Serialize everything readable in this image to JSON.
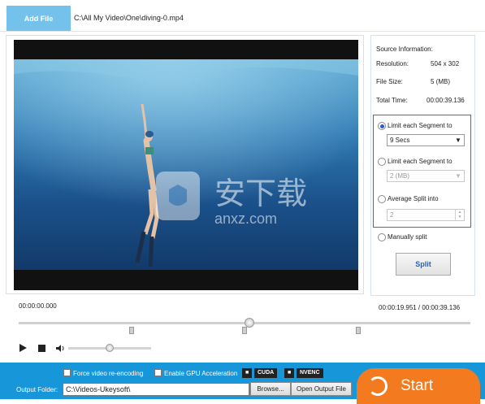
{
  "header": {
    "add_file_label": "Add File",
    "file_path": "C:\\All My Video\\One\\diving-0.mp4"
  },
  "info": {
    "title": "Source Information:",
    "resolution_label": "Resolution:",
    "resolution_value": "504 x 302",
    "filesize_label": "File Size:",
    "filesize_value": "5 (MB)",
    "totaltime_label": "Total Time:",
    "totaltime_value": "00:00:39.136"
  },
  "split_options": {
    "opt1_label": "Limit each Segment to",
    "opt1_value": "9 Secs",
    "opt2_label": "Limit each Segment to",
    "opt2_value": "2 (MB)",
    "opt3_label": "Average Split into",
    "opt3_value": "2",
    "opt4_label": "Manually split",
    "selected": "opt1"
  },
  "split_button_label": "Split",
  "timeline": {
    "current_time": "00:00:00.000",
    "position_display": "00:00:19.951 / 00:00:39.136"
  },
  "bottom": {
    "force_reencoding_label": "Force video re-encoding",
    "gpu_label": "Enable GPU Acceleration",
    "cuda_badge": "CUDA",
    "nvenc_badge": "NVENC",
    "output_folder_label": "Output Folder:",
    "output_folder_value": "C:\\Videos-Ukeysoft\\",
    "browse_label": "Browse...",
    "open_output_label": "Open Output File",
    "start_label": "Start"
  },
  "watermark": {
    "cn_text": "安下载",
    "site_text": "anxz.com"
  },
  "colors": {
    "accent": "#1796d9",
    "add_file_bg": "#74c2ec",
    "start_bg": "#f47a1f",
    "highlight_border": "#d43a3a"
  }
}
